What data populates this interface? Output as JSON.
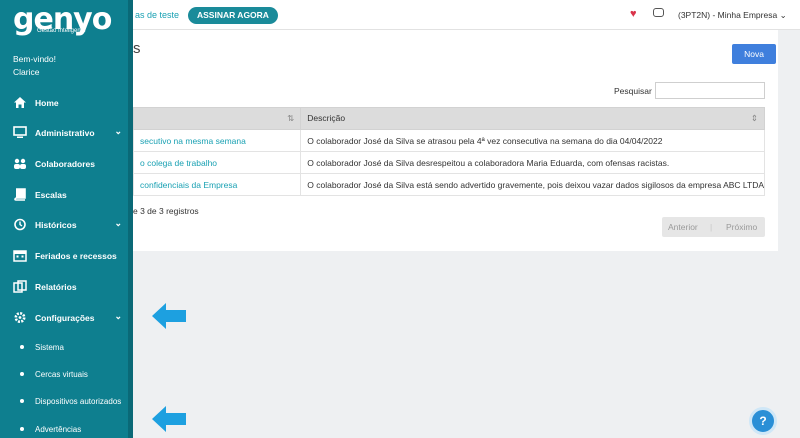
{
  "header": {
    "trial_text": "as de teste",
    "subscribe_label": "ASSINAR AGORA",
    "company_label": "(3PT2N) - Minha Empresa"
  },
  "brand": {
    "name": "genyo",
    "tagline": "Gestão Inteligente"
  },
  "user": {
    "welcome": "Bem-vindo!",
    "name": "Clarice"
  },
  "sidebar": {
    "items": [
      {
        "label": "Home",
        "icon": "home-icon"
      },
      {
        "label": "Administrativo",
        "icon": "monitor-icon"
      },
      {
        "label": "Colaboradores",
        "icon": "users-icon"
      },
      {
        "label": "Escalas",
        "icon": "book-icon"
      },
      {
        "label": "Históricos",
        "icon": "history-icon"
      },
      {
        "label": "Feriados e recessos",
        "icon": "calendar-icon"
      },
      {
        "label": "Relatórios",
        "icon": "copy-icon"
      },
      {
        "label": "Configurações",
        "icon": "gear-icon"
      }
    ],
    "subitems": [
      "Sistema",
      "Cercas virtuais",
      "Dispositivos autorizados",
      "Advertências"
    ]
  },
  "main": {
    "page_title": "s",
    "new_button": "Nova",
    "search_label": "Pesquisar",
    "search_value": "",
    "columns": [
      "",
      "Descrição"
    ],
    "rows": [
      [
        "secutivo na mesma semana",
        "O colaborador José da Silva se atrasou pela 4ª vez consecutiva na semana do dia 04/04/2022"
      ],
      [
        "o colega de trabalho",
        "O colaborador José da Silva desrespeitou a colaboradora Maria Eduarda, com ofensas racistas."
      ],
      [
        "confidenciais da Empresa",
        "O colaborador José da Silva está sendo advertido gravemente, pois deixou vazar dados sigilosos da empresa ABC LTDA"
      ]
    ],
    "info_text": "e 3 de 3 registros",
    "pagination": {
      "prev": "Anterior",
      "next": "Próximo"
    }
  },
  "help": {
    "label": "?"
  },
  "colors": {
    "sidebar": "#0e7f8f",
    "accent": "#1aa1b3",
    "primary_button": "#3f7fdd",
    "arrow": "#1da0e0",
    "heart": "#d9334a"
  }
}
